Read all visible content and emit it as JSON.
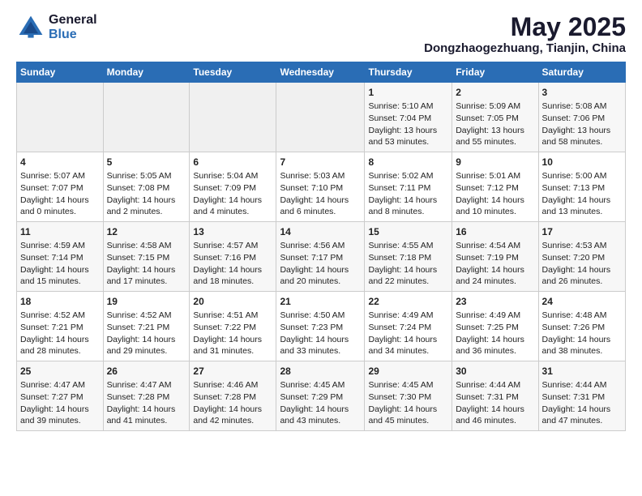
{
  "header": {
    "logo": {
      "general": "General",
      "blue": "Blue"
    },
    "month": "May 2025",
    "location": "Dongzhaogezhuang, Tianjin, China"
  },
  "days_of_week": [
    "Sunday",
    "Monday",
    "Tuesday",
    "Wednesday",
    "Thursday",
    "Friday",
    "Saturday"
  ],
  "weeks": [
    [
      {
        "day": "",
        "info": ""
      },
      {
        "day": "",
        "info": ""
      },
      {
        "day": "",
        "info": ""
      },
      {
        "day": "",
        "info": ""
      },
      {
        "day": "1",
        "info": "Sunrise: 5:10 AM\nSunset: 7:04 PM\nDaylight: 13 hours\nand 53 minutes."
      },
      {
        "day": "2",
        "info": "Sunrise: 5:09 AM\nSunset: 7:05 PM\nDaylight: 13 hours\nand 55 minutes."
      },
      {
        "day": "3",
        "info": "Sunrise: 5:08 AM\nSunset: 7:06 PM\nDaylight: 13 hours\nand 58 minutes."
      }
    ],
    [
      {
        "day": "4",
        "info": "Sunrise: 5:07 AM\nSunset: 7:07 PM\nDaylight: 14 hours\nand 0 minutes."
      },
      {
        "day": "5",
        "info": "Sunrise: 5:05 AM\nSunset: 7:08 PM\nDaylight: 14 hours\nand 2 minutes."
      },
      {
        "day": "6",
        "info": "Sunrise: 5:04 AM\nSunset: 7:09 PM\nDaylight: 14 hours\nand 4 minutes."
      },
      {
        "day": "7",
        "info": "Sunrise: 5:03 AM\nSunset: 7:10 PM\nDaylight: 14 hours\nand 6 minutes."
      },
      {
        "day": "8",
        "info": "Sunrise: 5:02 AM\nSunset: 7:11 PM\nDaylight: 14 hours\nand 8 minutes."
      },
      {
        "day": "9",
        "info": "Sunrise: 5:01 AM\nSunset: 7:12 PM\nDaylight: 14 hours\nand 10 minutes."
      },
      {
        "day": "10",
        "info": "Sunrise: 5:00 AM\nSunset: 7:13 PM\nDaylight: 14 hours\nand 13 minutes."
      }
    ],
    [
      {
        "day": "11",
        "info": "Sunrise: 4:59 AM\nSunset: 7:14 PM\nDaylight: 14 hours\nand 15 minutes."
      },
      {
        "day": "12",
        "info": "Sunrise: 4:58 AM\nSunset: 7:15 PM\nDaylight: 14 hours\nand 17 minutes."
      },
      {
        "day": "13",
        "info": "Sunrise: 4:57 AM\nSunset: 7:16 PM\nDaylight: 14 hours\nand 18 minutes."
      },
      {
        "day": "14",
        "info": "Sunrise: 4:56 AM\nSunset: 7:17 PM\nDaylight: 14 hours\nand 20 minutes."
      },
      {
        "day": "15",
        "info": "Sunrise: 4:55 AM\nSunset: 7:18 PM\nDaylight: 14 hours\nand 22 minutes."
      },
      {
        "day": "16",
        "info": "Sunrise: 4:54 AM\nSunset: 7:19 PM\nDaylight: 14 hours\nand 24 minutes."
      },
      {
        "day": "17",
        "info": "Sunrise: 4:53 AM\nSunset: 7:20 PM\nDaylight: 14 hours\nand 26 minutes."
      }
    ],
    [
      {
        "day": "18",
        "info": "Sunrise: 4:52 AM\nSunset: 7:21 PM\nDaylight: 14 hours\nand 28 minutes."
      },
      {
        "day": "19",
        "info": "Sunrise: 4:52 AM\nSunset: 7:21 PM\nDaylight: 14 hours\nand 29 minutes."
      },
      {
        "day": "20",
        "info": "Sunrise: 4:51 AM\nSunset: 7:22 PM\nDaylight: 14 hours\nand 31 minutes."
      },
      {
        "day": "21",
        "info": "Sunrise: 4:50 AM\nSunset: 7:23 PM\nDaylight: 14 hours\nand 33 minutes."
      },
      {
        "day": "22",
        "info": "Sunrise: 4:49 AM\nSunset: 7:24 PM\nDaylight: 14 hours\nand 34 minutes."
      },
      {
        "day": "23",
        "info": "Sunrise: 4:49 AM\nSunset: 7:25 PM\nDaylight: 14 hours\nand 36 minutes."
      },
      {
        "day": "24",
        "info": "Sunrise: 4:48 AM\nSunset: 7:26 PM\nDaylight: 14 hours\nand 38 minutes."
      }
    ],
    [
      {
        "day": "25",
        "info": "Sunrise: 4:47 AM\nSunset: 7:27 PM\nDaylight: 14 hours\nand 39 minutes."
      },
      {
        "day": "26",
        "info": "Sunrise: 4:47 AM\nSunset: 7:28 PM\nDaylight: 14 hours\nand 41 minutes."
      },
      {
        "day": "27",
        "info": "Sunrise: 4:46 AM\nSunset: 7:28 PM\nDaylight: 14 hours\nand 42 minutes."
      },
      {
        "day": "28",
        "info": "Sunrise: 4:45 AM\nSunset: 7:29 PM\nDaylight: 14 hours\nand 43 minutes."
      },
      {
        "day": "29",
        "info": "Sunrise: 4:45 AM\nSunset: 7:30 PM\nDaylight: 14 hours\nand 45 minutes."
      },
      {
        "day": "30",
        "info": "Sunrise: 4:44 AM\nSunset: 7:31 PM\nDaylight: 14 hours\nand 46 minutes."
      },
      {
        "day": "31",
        "info": "Sunrise: 4:44 AM\nSunset: 7:31 PM\nDaylight: 14 hours\nand 47 minutes."
      }
    ]
  ]
}
